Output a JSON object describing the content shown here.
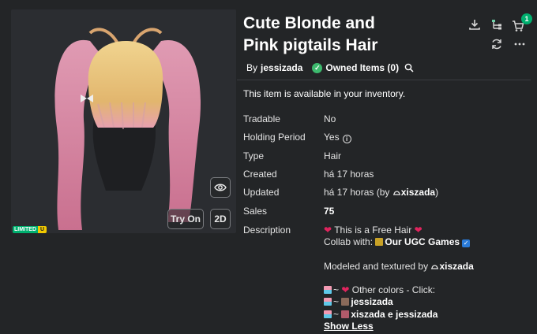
{
  "item": {
    "title_line1": "Cute Blonde and",
    "title_line2": "Pink pigtails Hair",
    "by_label": "By",
    "creator": "jessizada",
    "owned_label": "Owned Items (0)",
    "availability": "This item is available in your inventory."
  },
  "preview": {
    "try_on_label": "Try On",
    "view_2d_label": "2D",
    "limited_label": "LIMITED",
    "limited_u_label": "U"
  },
  "toolbar": {
    "cart_count": "1"
  },
  "details": [
    {
      "label": "Tradable",
      "value": "No"
    },
    {
      "label": "Holding Period",
      "value": "Yes"
    },
    {
      "label": "Type",
      "value": "Hair"
    },
    {
      "label": "Created",
      "value": "há 17 horas"
    },
    {
      "label": "Updated",
      "value": "há 17 horas (by",
      "user": "xiszada",
      "close": ")"
    },
    {
      "label": "Sales",
      "value": "75"
    },
    {
      "label": "Description",
      "value": ""
    }
  ],
  "description": {
    "line1": "This is a Free Hair",
    "line2_prefix": "Collab with:",
    "line2_group": "Our UGC Games",
    "line3_prefix": "Modeled and textured by",
    "line3_user": "xiszada",
    "line4": "Other colors - Click:",
    "line5_user": "jessizada",
    "line6_users": "xiszada e jessizada",
    "show_less": "Show Less"
  },
  "colors": {
    "accent_green": "#00b06f",
    "background": "#232527",
    "hair_pink": "#d98aa8",
    "hair_blonde": "#e8c27a"
  }
}
